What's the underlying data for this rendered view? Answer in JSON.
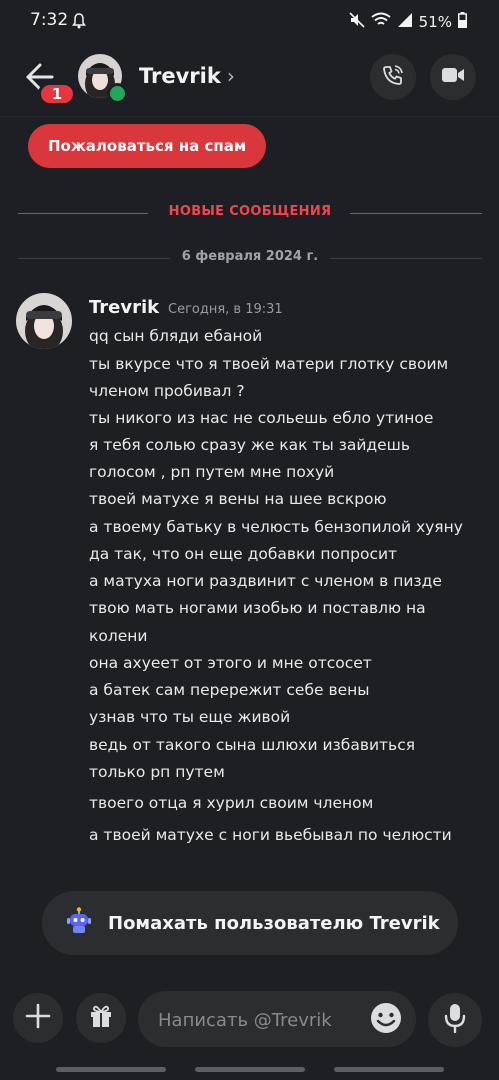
{
  "status_bar": {
    "time": "7:32",
    "battery": "51%"
  },
  "header": {
    "badge_count": "1",
    "username": "Trevrik",
    "chevron": "›",
    "icons": {
      "back": "back-arrow-icon",
      "call": "phone-call-icon",
      "video": "video-camera-icon"
    }
  },
  "spam_button": "Пожаловаться на спам",
  "dividers": {
    "new_messages": "НОВЫЕ СООБЩЕНИЯ",
    "date": "6 февраля 2024 г."
  },
  "message": {
    "author": "Trevrik",
    "timestamp": "Сегодня, в 19:31",
    "lines": [
      "qq сын бляди ебаной",
      "ты вкурсе что я твоей матери глотку своим",
      "членом пробивал ?",
      "ты никого из нас не сольешь ебло утиное",
      "я тебя солью сразу же как ты зайдешь",
      "голосом , рп путем мне похуй",
      "твоей матухе я вены на шее вскрою",
      "а твоему батьку в челюсть бензопилой хуяну",
      "да так, что он еще добавки попросит",
      "а матуха ноги раздвинит с членом в пизде",
      "твою мать ногами изобью и поставлю на",
      "колени",
      "она ахуеет от этого и мне отсосет",
      "а батек сам перережит себе вены",
      "узнав что ты еще живой",
      "ведь от такого сына шлюхи избавиться",
      "только рп путем",
      "твоего отца я хурил своим членом",
      "а твоей матухе с ноги вьебывал по челюсти"
    ]
  },
  "wave_button": {
    "label": "Помахать пользователю Trevrik",
    "icon": "wave-robot-icon"
  },
  "input_bar": {
    "placeholder": "Написать @Trevrik",
    "icons": {
      "plus": "plus-icon",
      "gift": "gift-icon",
      "emoji": "emoji-icon",
      "mic": "microphone-icon"
    }
  },
  "colors": {
    "background": "#1e1f24",
    "danger": "#da373c",
    "online": "#23a55a",
    "surface": "#2b2d31"
  }
}
